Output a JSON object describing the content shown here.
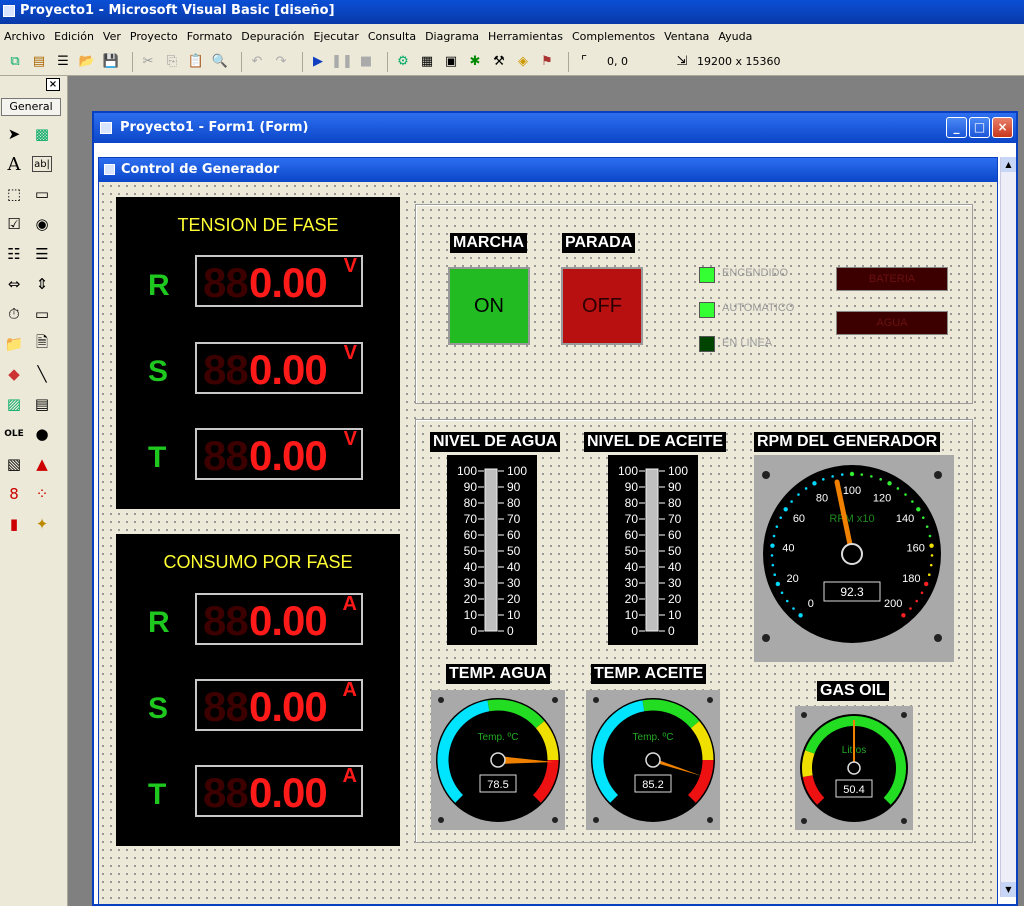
{
  "app": {
    "title": "Proyecto1 - Microsoft Visual Basic [diseño]"
  },
  "menu": [
    "Archivo",
    "Edición",
    "Ver",
    "Proyecto",
    "Formato",
    "Depuración",
    "Ejecutar",
    "Consulta",
    "Diagrama",
    "Herramientas",
    "Complementos",
    "Ventana",
    "Ayuda"
  ],
  "toolbar": {
    "coords": "0, 0",
    "size": "19200 x 15360"
  },
  "toolbox": {
    "close": "×",
    "tab": "General"
  },
  "form_window": {
    "title": "Proyecto1 - Form1 (Form)",
    "min": "_",
    "max": "□",
    "close": "×"
  },
  "form": {
    "title": "Control de Generador"
  },
  "tension": {
    "title": "TENSION DE FASE",
    "unit": "V",
    "phases": [
      "R",
      "S",
      "T"
    ],
    "ghost": "88",
    "values": [
      "0.00",
      "0.00",
      "0.00"
    ]
  },
  "consumo": {
    "title": "CONSUMO POR FASE",
    "unit": "A",
    "phases": [
      "R",
      "S",
      "T"
    ],
    "ghost": "88",
    "values": [
      "0.00",
      "0.00",
      "0.00"
    ]
  },
  "control": {
    "marcha_label": "MARCHA",
    "parada_label": "PARADA",
    "on_label": "ON",
    "off_label": "OFF",
    "leds": [
      {
        "label": "ENCENDIDO",
        "color": "#33ff33"
      },
      {
        "label": "AUTOMATICO",
        "color": "#33ff33"
      },
      {
        "label": "EN LINEA",
        "color": "#004400"
      }
    ],
    "alarms": [
      "BATERIA",
      "AGUA"
    ]
  },
  "levels": {
    "agua_title": "NIVEL DE AGUA",
    "aceite_title": "NIVEL DE ACEITE",
    "ticks": [
      "100",
      "90",
      "80",
      "70",
      "60",
      "50",
      "40",
      "30",
      "20",
      "10",
      "0"
    ]
  },
  "rpm": {
    "title": "RPM DEL GENERADOR",
    "label": "RPM x10",
    "value": "92.3",
    "ticks": [
      "0",
      "20",
      "40",
      "60",
      "80",
      "100",
      "120",
      "140",
      "160",
      "180",
      "200"
    ]
  },
  "temp_agua": {
    "title": "TEMP. AGUA",
    "label": "Temp. ºC",
    "value": "78.5"
  },
  "temp_aceite": {
    "title": "TEMP. ACEITE",
    "label": "Temp. ºC",
    "value": "85.2"
  },
  "gasoil": {
    "title": "GAS OIL",
    "label": "Litros",
    "value": "50.4"
  }
}
